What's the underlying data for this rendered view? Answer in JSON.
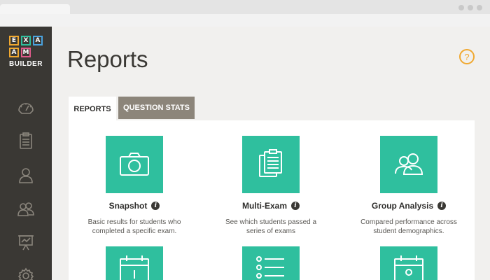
{
  "logo": {
    "letters": [
      "E",
      "X",
      "A",
      "M"
    ],
    "word": "BUILDER"
  },
  "sidebar": {
    "icons": [
      "dashboard-icon",
      "clipboard-icon",
      "user-icon",
      "users-icon",
      "presentation-icon",
      "gear-icon"
    ]
  },
  "page": {
    "title": "Reports",
    "help_symbol": "?"
  },
  "tabs": [
    {
      "label": "REPORTS",
      "active": true
    },
    {
      "label": "QUESTION STATS",
      "active": false
    }
  ],
  "cards": [
    {
      "title": "Snapshot",
      "description": "Basic results for students who completed a specific exam.",
      "icon": "camera-icon"
    },
    {
      "title": "Multi-Exam",
      "description": "See which students passed a series of exams",
      "icon": "clipboard-stack-icon"
    },
    {
      "title": "Group Analysis",
      "description": "Compared performance across student demographics.",
      "icon": "people-icon"
    }
  ],
  "bottom_cards": [
    {
      "icon": "calendar-icon"
    },
    {
      "icon": "list-icon"
    },
    {
      "icon": "calendar-person-icon"
    }
  ],
  "info_symbol": "i",
  "colors": {
    "accent": "#2fbf9e",
    "logo_orange": "#f0a830",
    "sidebar_bg": "#3a3834",
    "tab_inactive": "#8c857a"
  }
}
